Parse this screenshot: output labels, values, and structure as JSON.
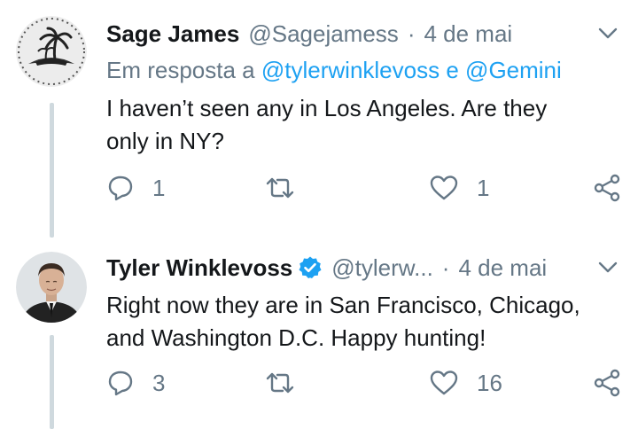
{
  "tweets": [
    {
      "author_name": "Sage James",
      "handle": "@Sagejamess",
      "separator": "·",
      "date": "4 de mai",
      "reply_prefix": "Em resposta a",
      "reply_mention_1": "@tylerwinklevoss",
      "reply_conj": "e",
      "reply_mention_2": "@Gemini",
      "text_line_1": "I haven’t seen any in Los Angeles. Are they",
      "text_line_2": "only in NY?",
      "reply_count": "1",
      "retweet_count": "",
      "like_count": "1",
      "verified": false,
      "avatar_icon": "palm-tree-island-avatar"
    },
    {
      "author_name": "Tyler Winklevoss",
      "handle": "@tylerw...",
      "separator": "·",
      "date": "4 de mai",
      "text_line_1": "Right now they are in San Francisco, Chicago,",
      "text_line_2": "and Washington D.C. Happy hunting!",
      "reply_count": "3",
      "retweet_count": "",
      "like_count": "16",
      "verified": true,
      "avatar_icon": "person-photo-avatar"
    }
  ],
  "icons": {
    "reply": "reply-icon",
    "retweet": "retweet-icon",
    "like": "heart-icon",
    "share": "share-icon",
    "menu": "chevron-down-icon",
    "verified": "verified-badge-icon"
  },
  "colors": {
    "text": "#14171a",
    "muted": "#657786",
    "link": "#1da1f2",
    "thread_line": "#cfd9de",
    "background": "#ffffff"
  }
}
